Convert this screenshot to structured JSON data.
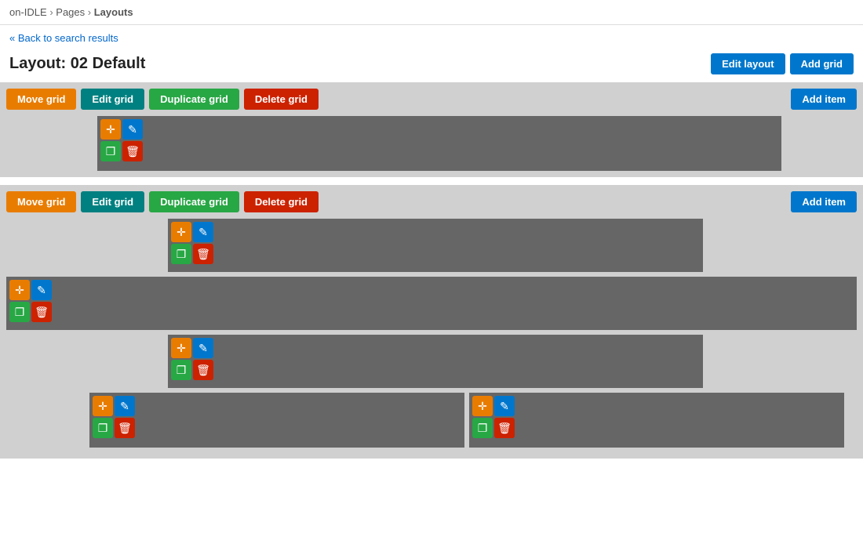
{
  "breadcrumb": {
    "items": [
      "on-IDLE",
      "Pages",
      "Layouts"
    ]
  },
  "back_link": {
    "text": "« Back to search results",
    "href": "#"
  },
  "page_title": "Layout: 02 Default",
  "header_buttons": {
    "edit_layout": "Edit layout",
    "add_grid": "Add grid"
  },
  "grid1": {
    "toolbar": {
      "move": "Move grid",
      "edit": "Edit grid",
      "duplicate": "Duplicate grid",
      "delete": "Delete grid",
      "add_item": "Add item"
    }
  },
  "grid2": {
    "toolbar": {
      "move": "Move grid",
      "edit": "Edit grid",
      "duplicate": "Duplicate grid",
      "delete": "Delete grid",
      "add_item": "Add item"
    }
  },
  "icons": {
    "move": "✛",
    "edit": "✎",
    "duplicate": "❐",
    "delete": "🗑"
  }
}
